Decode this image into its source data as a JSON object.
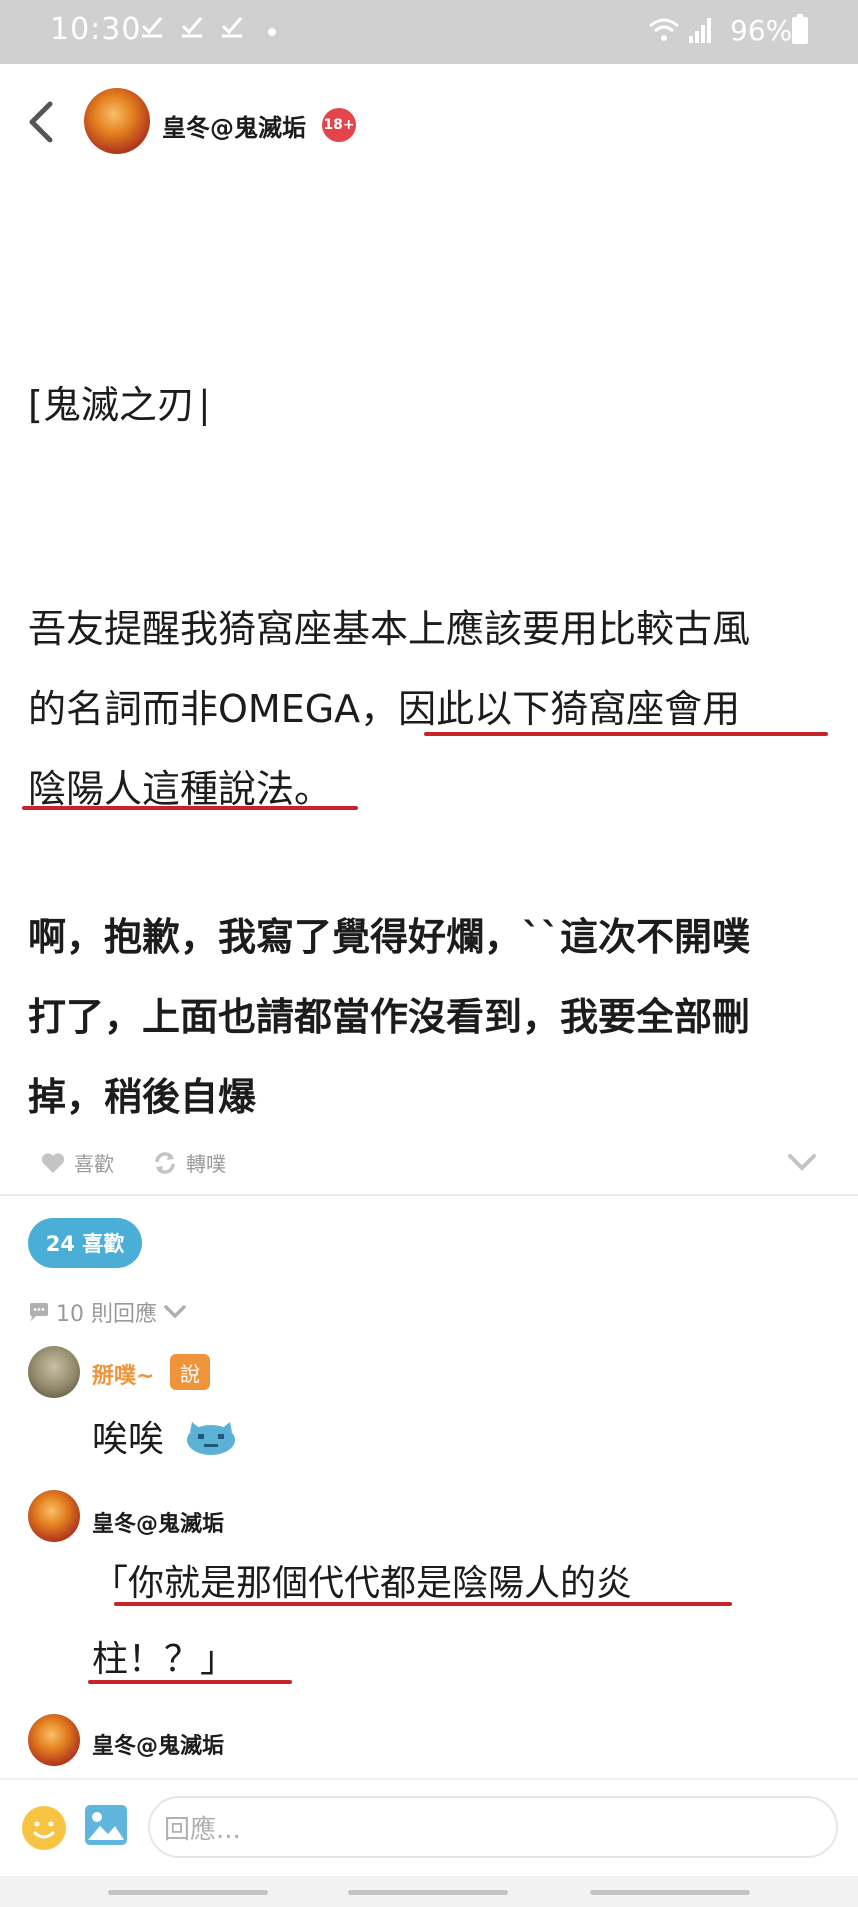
{
  "status_bar": {
    "time": "10:30",
    "battery": "96%",
    "icons": [
      "check-icon",
      "check-icon",
      "check-icon",
      "dot-icon",
      "wifi-icon",
      "signal-icon",
      "battery-icon"
    ]
  },
  "header": {
    "name": "皇冬@鬼滅垢",
    "badge": "18+"
  },
  "post": {
    "lines": [
      "[鬼滅之刃∣",
      "吾友提醒我猗窩座基本上應該要用比較古風",
      "的名詞而非OMEGA，因此以下猗窩座會用",
      "陰陽人這種說法。",
      "啊，抱歉，我寫了覺得好爛，``這次不開噗",
      "打了，上面也請都當作沒看到，我要全部刪",
      "掉，稍後自爆"
    ]
  },
  "actions": {
    "like": "喜歡",
    "replurk": "轉噗"
  },
  "likes_pill": "24 喜歡",
  "reply_count": "10 則回應",
  "comments": [
    {
      "name": "掰噗~",
      "badge": "說",
      "text": "唉唉"
    },
    {
      "name": "皇冬@鬼滅垢",
      "lines": [
        "「你就是那個代代都是陰陽人的炎",
        "柱！？」"
      ]
    },
    {
      "name": "皇冬@鬼滅垢"
    }
  ],
  "input": {
    "placeholder": "回應..."
  },
  "colors": {
    "accent": "#4baed6",
    "underline": "#c8232c",
    "badge": "#e4444a",
    "orange": "#f0943c"
  }
}
